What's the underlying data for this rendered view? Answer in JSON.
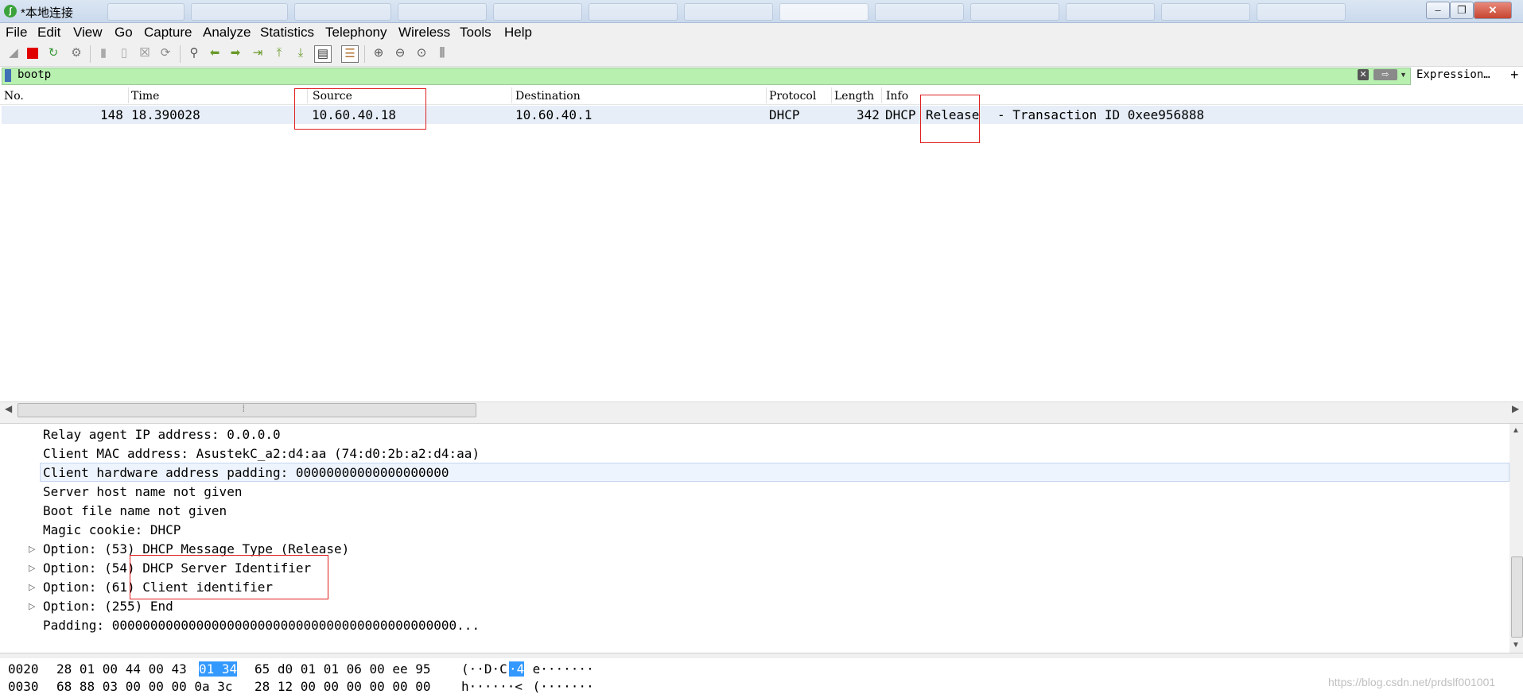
{
  "window": {
    "title": "*本地连接",
    "app_icon": "wireshark-icon"
  },
  "menu": [
    "File",
    "Edit",
    "View",
    "Go",
    "Capture",
    "Analyze",
    "Statistics",
    "Telephony",
    "Wireless",
    "Tools",
    "Help"
  ],
  "filter": {
    "value": "bootp",
    "expression_label": "Expression…",
    "add_label": "+"
  },
  "packet_list": {
    "columns": [
      "No.",
      "Time",
      "Source",
      "Destination",
      "Protocol",
      "Length",
      "Info"
    ],
    "rows": [
      {
        "no": "148",
        "time": "18.390028",
        "source": "10.60.40.18",
        "destination": "10.60.40.1",
        "protocol": "DHCP",
        "length": "342",
        "info_proto": "DHCP",
        "info_type": "Release",
        "info_rest": "- Transaction ID 0xee956888"
      }
    ]
  },
  "details": {
    "lines": [
      "Relay agent IP address: 0.0.0.0",
      "Client MAC address: AsustekC_a2:d4:aa (74:d0:2b:a2:d4:aa)",
      "Client hardware address padding: 00000000000000000000",
      "Server host name not given",
      "Boot file name not given",
      "Magic cookie: DHCP",
      "Option: (53) DHCP Message Type (Release)",
      "Option: (54) DHCP Server Identifier",
      "Option: (61) Client identifier",
      "Option: (255) End",
      "Padding: 000000000000000000000000000000000000000000000..."
    ]
  },
  "bytes": {
    "rows": [
      {
        "offset": "0020",
        "hex_a": "28 01 00 44 00 43",
        "hex_hl": "01 34",
        "hex_b": "65 d0 01 01 06 00 ee 95",
        "ascii_a": "(··D·C",
        "ascii_hl": "·4",
        "ascii_b": " e·······"
      },
      {
        "offset": "0030",
        "hex_a": "68 88 03 00 00 00 0a 3c",
        "hex_hl": "",
        "hex_b": "28 12 00 00 00 00 00 00",
        "ascii_a": "h······<",
        "ascii_hl": "",
        "ascii_b": " (·······"
      }
    ]
  },
  "watermark": "https://blog.csdn.net/prdslf001001"
}
